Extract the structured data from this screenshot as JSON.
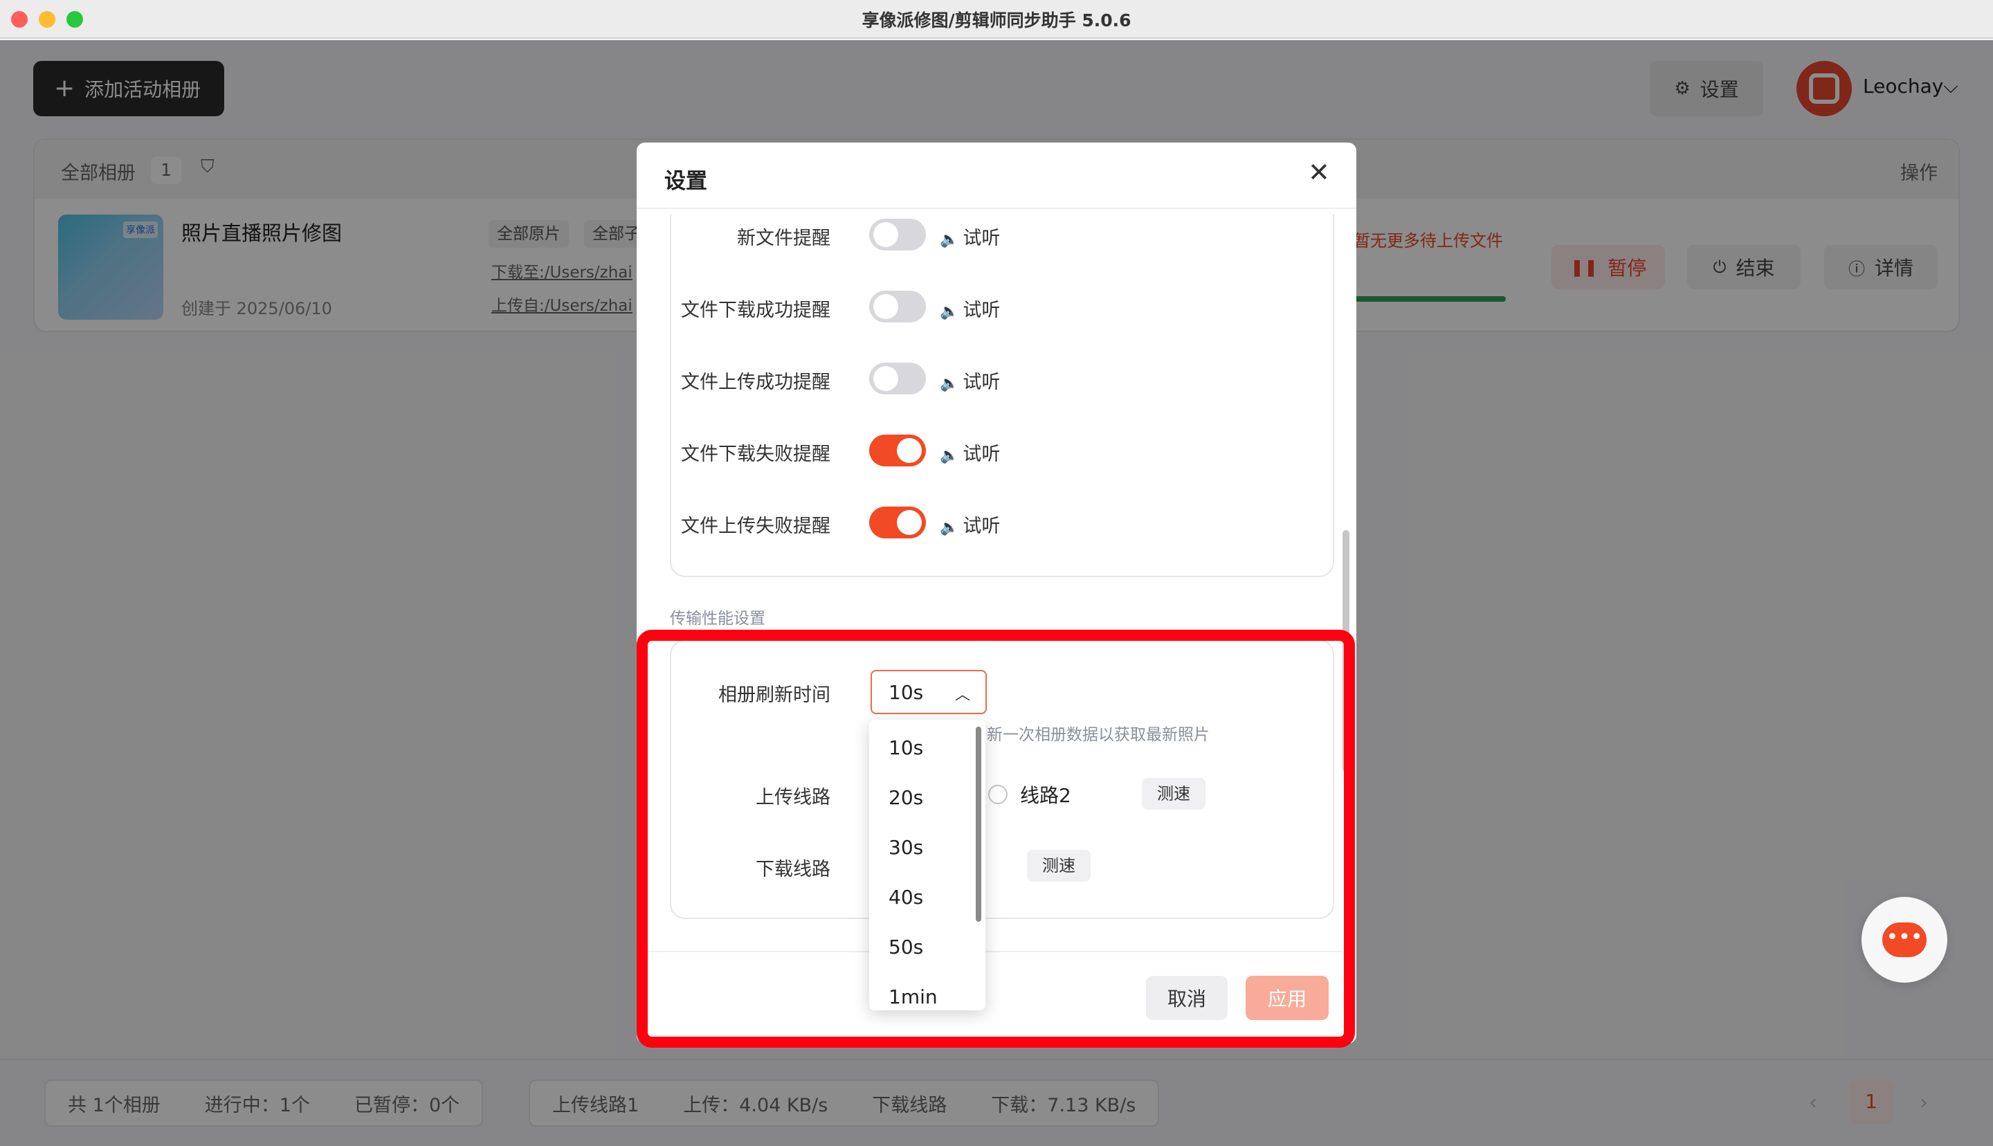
{
  "window": {
    "title": "享像派修图/剪辑师同步助手 5.0.6"
  },
  "toolbar": {
    "add_icon": "plus-icon",
    "add_label": "添加活动相册",
    "settings_icon": "gear-icon",
    "settings_label": "设置",
    "user_name": "Leochay",
    "user_chevron": "⌵"
  },
  "table": {
    "all_albums_label": "全部相册",
    "album_count": "1",
    "filter_icon": "funnel-icon",
    "ops_header": "操作",
    "row": {
      "thumb_badge": "享像派",
      "name": "照片直播照片修图",
      "created": "创建于 2025/06/10",
      "tags": [
        "全部原片",
        "全部子"
      ],
      "download_path": "下载至:/Users/zhai",
      "upload_path": "上传自:/Users/zhai",
      "upload_note": "暂无更多待上传文件",
      "progress": 1.0,
      "pause_label": "暂停",
      "end_label": "结束",
      "detail_label": "详情"
    }
  },
  "footer": {
    "total": "共 1个相册",
    "running": "进行中：1个",
    "paused": "已暂停：0个",
    "upload_route": "上传线路1",
    "upload_speed": "上传：4.04 KB/s",
    "download_route": "下载线路",
    "download_speed": "下载：7.13 KB/s",
    "current_page": "1",
    "prev": "‹",
    "next": "›"
  },
  "modal": {
    "title": "设置",
    "close_glyph": "✕",
    "notifications": [
      {
        "label": "新文件提醒",
        "on": false,
        "try_label": "试听"
      },
      {
        "label": "文件下载成功提醒",
        "on": false,
        "try_label": "试听"
      },
      {
        "label": "文件上传成功提醒",
        "on": false,
        "try_label": "试听"
      },
      {
        "label": "文件下载失败提醒",
        "on": true,
        "try_label": "试听"
      },
      {
        "label": "文件上传失败提醒",
        "on": true,
        "try_label": "试听"
      }
    ],
    "perf_section_title": "传输性能设置",
    "refresh": {
      "label": "相册刷新时间",
      "value": "10s",
      "help": "新一次相册数据以获取最新照片",
      "options": [
        "10s",
        "20s",
        "30s",
        "40s",
        "50s",
        "1min"
      ]
    },
    "upload_route": {
      "label": "上传线路",
      "option2": "线路2",
      "speed_test": "测速"
    },
    "download_route": {
      "label": "下载线路",
      "speed_test": "测速"
    },
    "cancel_label": "取消",
    "apply_label": "应用"
  },
  "support_icon": "customer-service-icon",
  "colors": {
    "accent": "#f24a24",
    "highlight": "#ff0010",
    "progress": "#2e9e4f"
  }
}
